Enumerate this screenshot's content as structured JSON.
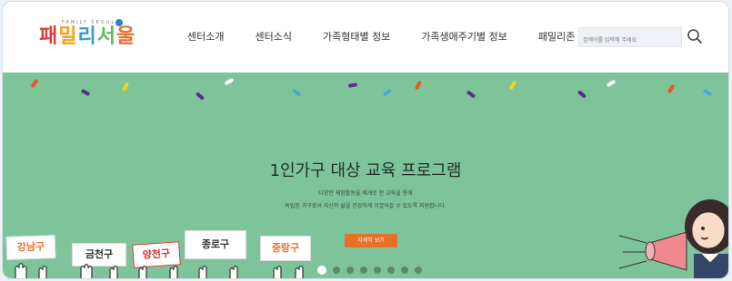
{
  "logo": {
    "tagline": "FAMILY SEOUL",
    "text": "패밀리서울"
  },
  "nav": {
    "items": [
      "센터소개",
      "센터소식",
      "가족형태별 정보",
      "가족생애주기별 정보",
      "패밀리존"
    ]
  },
  "search": {
    "placeholder": "검색어를 입력해 주세요"
  },
  "hero": {
    "title": "1인가구 대상 교육 프로그램",
    "subtitle_line1": "다양한 체험활동을 매개로 한 교육을 통해",
    "subtitle_line2": "독립된 가구로서 자신의 삶을 건강하게 이끌어갈 수 있도록 지원합니다.",
    "more_label": "자세히 보기",
    "signs": [
      "강남구",
      "금천구",
      "양천구",
      "종로구",
      "중랑구"
    ],
    "slide_count": 8,
    "active_slide": 1
  },
  "colors": {
    "hero_bg": "#7ec49a",
    "accent": "#e8712a"
  }
}
